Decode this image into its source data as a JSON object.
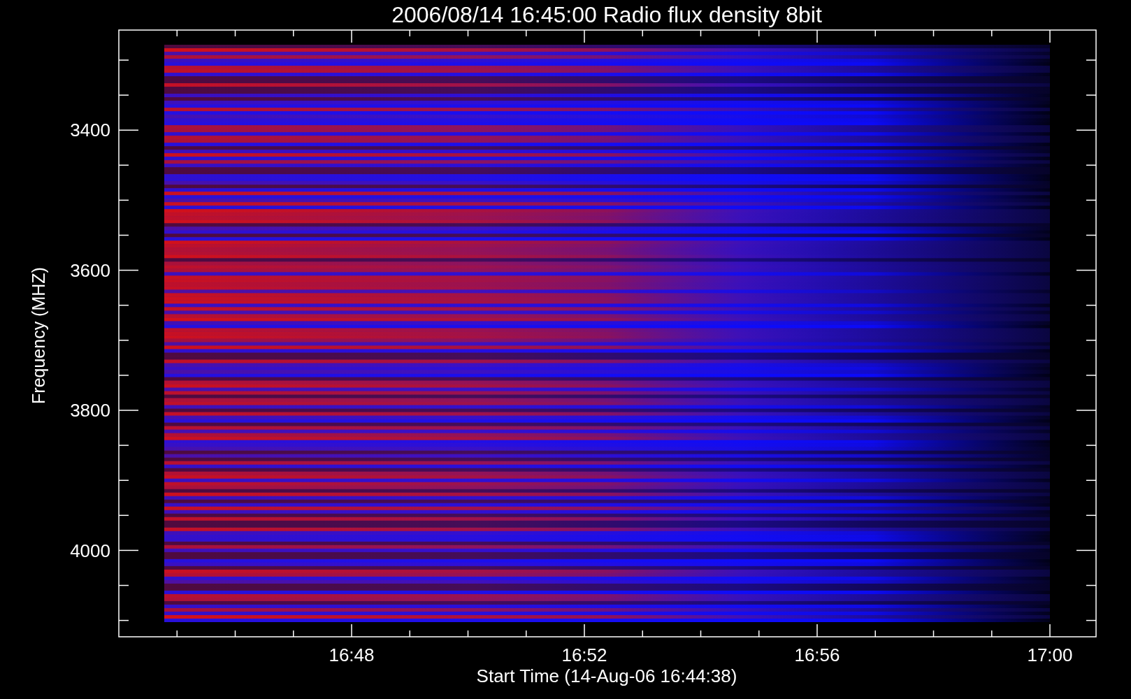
{
  "title": "2006/08/14 16:45:00 Radio flux density 8bit",
  "y_axis": {
    "label": "Frequency (MHZ)",
    "ticks": [
      "3400",
      "3600",
      "3800",
      "4000"
    ]
  },
  "x_axis": {
    "label": "Start Time (14-Aug-06 16:44:38)",
    "ticks": [
      "16:48",
      "16:52",
      "16:56",
      "17:00"
    ]
  }
}
